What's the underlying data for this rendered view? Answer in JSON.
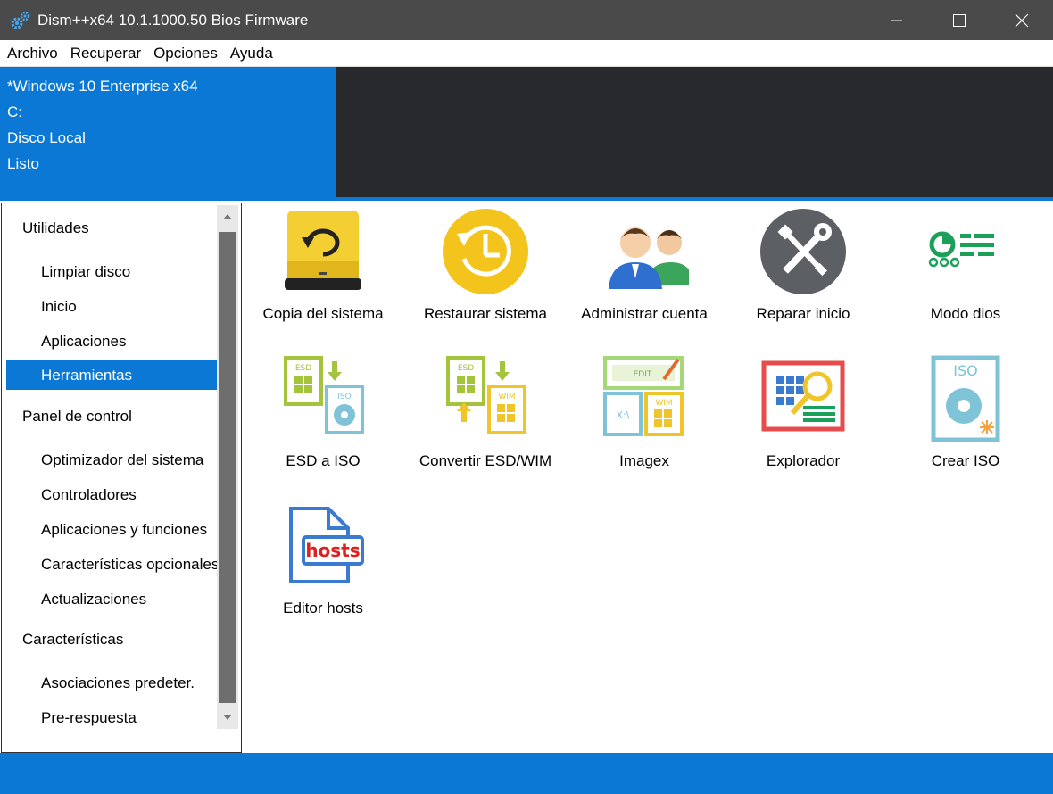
{
  "window": {
    "title": "Dism++x64 10.1.1000.50 Bios Firmware"
  },
  "menu": [
    "Archivo",
    "Recuperar",
    "Opciones",
    "Ayuda"
  ],
  "info": {
    "os": "*Windows 10 Enterprise x64",
    "drive": "C:",
    "disk": "Disco Local",
    "status": "Listo"
  },
  "sidebar": {
    "groups": [
      {
        "label": "Utilidades",
        "items": [
          "Limpiar disco",
          "Inicio",
          "Aplicaciones",
          "Herramientas"
        ]
      },
      {
        "label": "Panel de control",
        "items": [
          "Optimizador del sistema",
          "Controladores",
          "Aplicaciones y funciones",
          "Características opcionales",
          "Actualizaciones"
        ]
      },
      {
        "label": "Características",
        "items": [
          "Asociaciones predeter.",
          "Pre-respuesta"
        ]
      }
    ],
    "selected": "Herramientas"
  },
  "tools": [
    {
      "label": "Copia del sistema",
      "icon": "system-backup-drive-icon"
    },
    {
      "label": "Restaurar sistema",
      "icon": "restore-clock-icon"
    },
    {
      "label": "Administrar cuenta",
      "icon": "users-icon"
    },
    {
      "label": "Reparar inicio",
      "icon": "repair-tools-icon"
    },
    {
      "label": "Modo dios",
      "icon": "god-mode-icon"
    },
    {
      "label": "ESD a ISO",
      "icon": "esd-to-iso-icon"
    },
    {
      "label": "Convertir ESD/WIM",
      "icon": "convert-esd-wim-icon"
    },
    {
      "label": "Imagex",
      "icon": "imagex-icon"
    },
    {
      "label": "Explorador",
      "icon": "explorer-search-icon"
    },
    {
      "label": "Crear ISO",
      "icon": "create-iso-icon"
    },
    {
      "label": "Editor hosts",
      "icon": "hosts-file-icon"
    }
  ],
  "icon_text": {
    "esd": "ESD",
    "iso": "ISO",
    "wim": "WIM",
    "edit": "EDIT",
    "xa": "X:\\",
    "hosts": "hosts"
  },
  "colors": {
    "accent": "#0a78d4",
    "titlebar": "#4a4a4a",
    "dark_panel": "#28292c"
  }
}
